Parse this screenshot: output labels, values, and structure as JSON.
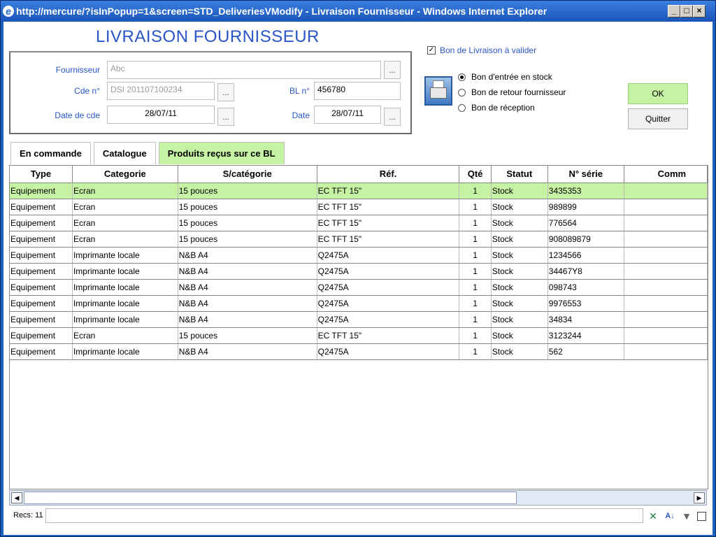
{
  "window": {
    "title": "http://mercure/?isInPopup=1&screen=STD_DeliveriesVModify - Livraison Fournisseur - Windows Internet Explorer",
    "minimize": "_",
    "maximize": "□",
    "close": "×"
  },
  "page_title": "LIVRAISON FOURNISSEUR",
  "form": {
    "fournisseur_label": "Fournisseur",
    "fournisseur_value": "Abc",
    "cde_label": "Cde n°",
    "cde_value": "DSI 201107100234",
    "bl_label": "BL n°",
    "bl_value": "456780",
    "date_cde_label": "Date de cde",
    "date_cde_value": "28/07/11",
    "date_label": "Date",
    "date_value": "28/07/11",
    "dots": "..."
  },
  "validate_checkbox": {
    "label": "Bon de Livraison à valider",
    "checked": true,
    "mark": "✓"
  },
  "radios": [
    {
      "label": "Bon d'entrée en stock",
      "selected": true
    },
    {
      "label": "Bon de retour fournisseur",
      "selected": false
    },
    {
      "label": "Bon de réception",
      "selected": false
    }
  ],
  "buttons": {
    "ok": "OK",
    "quit": "Quitter"
  },
  "tabs": [
    {
      "label": "En commande",
      "active": false
    },
    {
      "label": "Catalogue",
      "active": false
    },
    {
      "label": "Produits reçus sur ce BL",
      "active": true
    }
  ],
  "table": {
    "columns": [
      "Type",
      "Categorie",
      "S/catégorie",
      "Réf.",
      "Qté",
      "Statut",
      "N° série",
      "Comm"
    ],
    "rows": [
      [
        "Equipement",
        "Ecran",
        "15 pouces",
        "EC TFT 15\"",
        "1",
        "Stock",
        "3435353",
        ""
      ],
      [
        "Equipement",
        "Ecran",
        "15 pouces",
        "EC TFT 15\"",
        "1",
        "Stock",
        "989899",
        ""
      ],
      [
        "Equipement",
        "Ecran",
        "15 pouces",
        "EC TFT 15\"",
        "1",
        "Stock",
        "776564",
        ""
      ],
      [
        "Equipement",
        "Ecran",
        "15 pouces",
        "EC TFT 15\"",
        "1",
        "Stock",
        "908089879",
        ""
      ],
      [
        "Equipement",
        "Imprimante locale",
        "N&B A4",
        "Q2475A",
        "1",
        "Stock",
        "1234566",
        ""
      ],
      [
        "Equipement",
        "Imprimante locale",
        "N&B A4",
        "Q2475A",
        "1",
        "Stock",
        "34467Y8",
        ""
      ],
      [
        "Equipement",
        "Imprimante locale",
        "N&B A4",
        "Q2475A",
        "1",
        "Stock",
        "098743",
        ""
      ],
      [
        "Equipement",
        "Imprimante locale",
        "N&B A4",
        "Q2475A",
        "1",
        "Stock",
        "9976553",
        ""
      ],
      [
        "Equipement",
        "Imprimante locale",
        "N&B A4",
        "Q2475A",
        "1",
        "Stock",
        "34834",
        ""
      ],
      [
        "Equipement",
        "Ecran",
        "15 pouces",
        "EC TFT 15\"",
        "1",
        "Stock",
        "3123244",
        ""
      ],
      [
        "Equipement",
        "Imprimante locale",
        "N&B A4",
        "Q2475A",
        "1",
        "Stock",
        "562",
        ""
      ]
    ],
    "highlighted_row": 0
  },
  "scrollbar": {
    "left_arrow": "◀",
    "right_arrow": "▶"
  },
  "status": {
    "recs": "Recs: 11"
  },
  "icons": {
    "excel": "excel-icon",
    "sort": "sort-az-icon",
    "filter": "filter-icon"
  },
  "colors": {
    "accent_blue": "#2a55c8",
    "highlight_green": "#c6f2a4"
  }
}
